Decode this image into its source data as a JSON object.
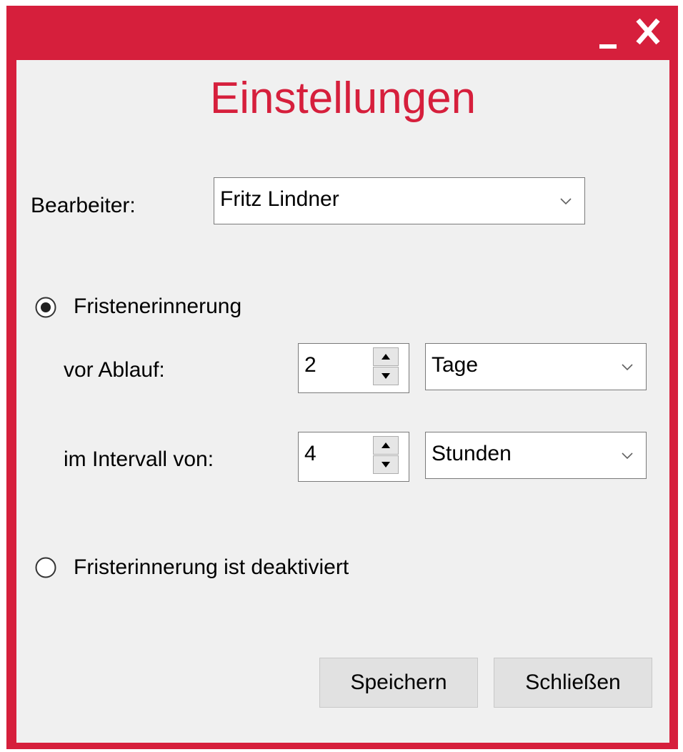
{
  "window": {
    "minimize_icon": "minimize-icon",
    "close_icon": "close-icon",
    "accent_color": "#d61f3c",
    "background_color": "#f0f0f0"
  },
  "title": "Einstellungen",
  "bearbeiter": {
    "label": "Bearbeiter:",
    "value": "Fritz Lindner"
  },
  "reminder_on": {
    "label": "Fristenerinnerung",
    "selected": true,
    "vor_ablauf": {
      "label": "vor Ablauf:",
      "number": "2",
      "unit": "Tage"
    },
    "intervall": {
      "label": "im Intervall von:",
      "number": "4",
      "unit": "Stunden"
    }
  },
  "reminder_off": {
    "label": "Fristerinnerung ist deaktiviert",
    "selected": false
  },
  "buttons": {
    "save": "Speichern",
    "close": "Schließen"
  }
}
